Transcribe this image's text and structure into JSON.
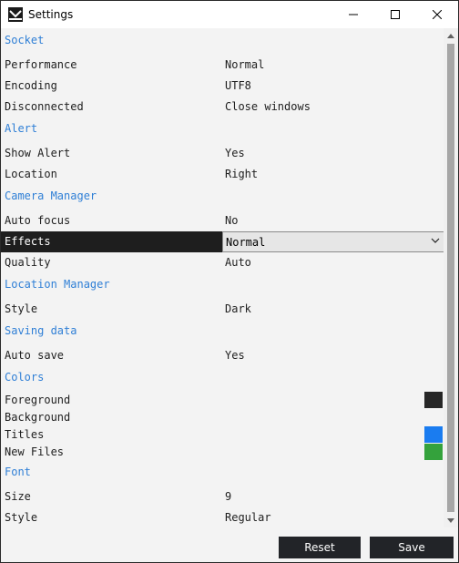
{
  "window": {
    "title": "Settings"
  },
  "sections": {
    "socket": "Socket",
    "alert": "Alert",
    "camera": "Camera Manager",
    "location_manager": "Location Manager",
    "saving": "Saving data",
    "colors": "Colors",
    "font": "Font"
  },
  "rows": {
    "performance": {
      "label": "Performance",
      "value": "Normal"
    },
    "encoding": {
      "label": "Encoding",
      "value": "UTF8"
    },
    "disconnected": {
      "label": "Disconnected",
      "value": "Close windows"
    },
    "show_alert": {
      "label": "Show Alert",
      "value": "Yes"
    },
    "location": {
      "label": "Location",
      "value": "Right"
    },
    "auto_focus": {
      "label": "Auto focus",
      "value": "No"
    },
    "effects": {
      "label": "Effects",
      "value": "Normal"
    },
    "quality": {
      "label": "Quality",
      "value": "Auto"
    },
    "style_loc": {
      "label": "Style",
      "value": "Dark"
    },
    "auto_save": {
      "label": "Auto save",
      "value": "Yes"
    },
    "foreground": {
      "label": "Foreground",
      "color": "#262626"
    },
    "background": {
      "label": "Background"
    },
    "titles": {
      "label": "Titles",
      "color": "#1a7cf0"
    },
    "new_files": {
      "label": "New Files",
      "color": "#34a23c"
    },
    "size": {
      "label": "Size",
      "value": "9"
    },
    "style_font": {
      "label": "Style",
      "value": "Regular"
    }
  },
  "buttons": {
    "reset": "Reset",
    "save": "Save"
  },
  "colors": {
    "section_blue": "#2f7fd6",
    "selected_row": "#1e1e1e",
    "button_dark": "#222428"
  },
  "icons": {
    "app": "app-logo-icon",
    "minimize": "minimize-icon",
    "maximize": "maximize-icon",
    "close": "close-icon",
    "dropdown": "chevron-down-icon",
    "scroll_up": "scroll-up-arrow-icon",
    "scroll_down": "scroll-down-arrow-icon"
  }
}
